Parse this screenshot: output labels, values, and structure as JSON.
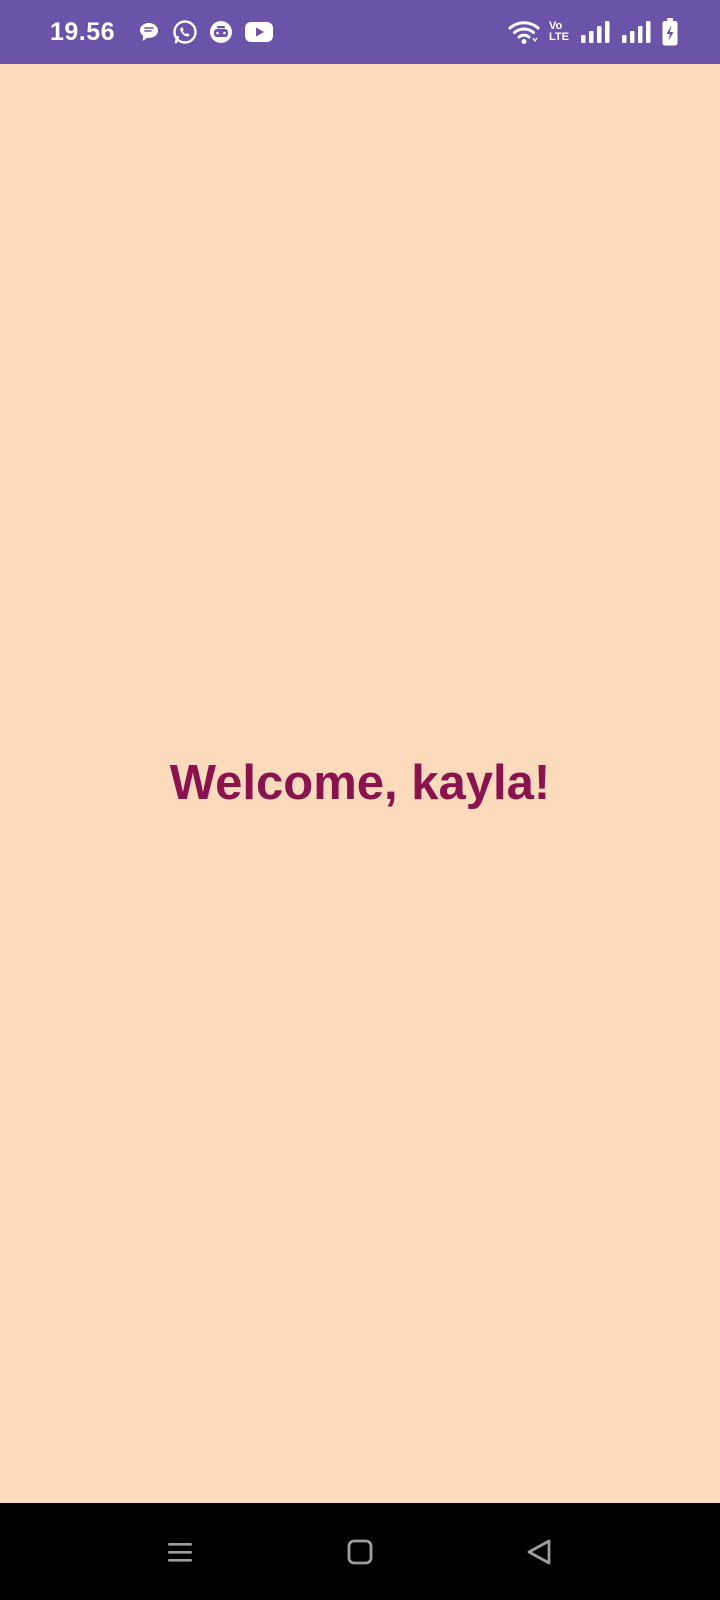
{
  "status_bar": {
    "time": "19.56",
    "background_color": "#6A53A8",
    "notification_icons": [
      "chat-bubble-icon",
      "whatsapp-icon",
      "game-controller-icon",
      "youtube-icon"
    ],
    "system_icons": [
      "wifi-icon",
      "volte-icon",
      "signal-sim1-icon",
      "signal-sim2-icon",
      "battery-charging-icon"
    ],
    "volte_top": "Vo",
    "volte_bottom": "LTE"
  },
  "main": {
    "background_color": "#FCDBBC",
    "welcome_text": "Welcome, kayla!",
    "welcome_color": "#8A134F"
  },
  "nav_bar": {
    "background_color": "#000000",
    "buttons": [
      "menu-icon",
      "home-icon",
      "back-icon"
    ]
  }
}
